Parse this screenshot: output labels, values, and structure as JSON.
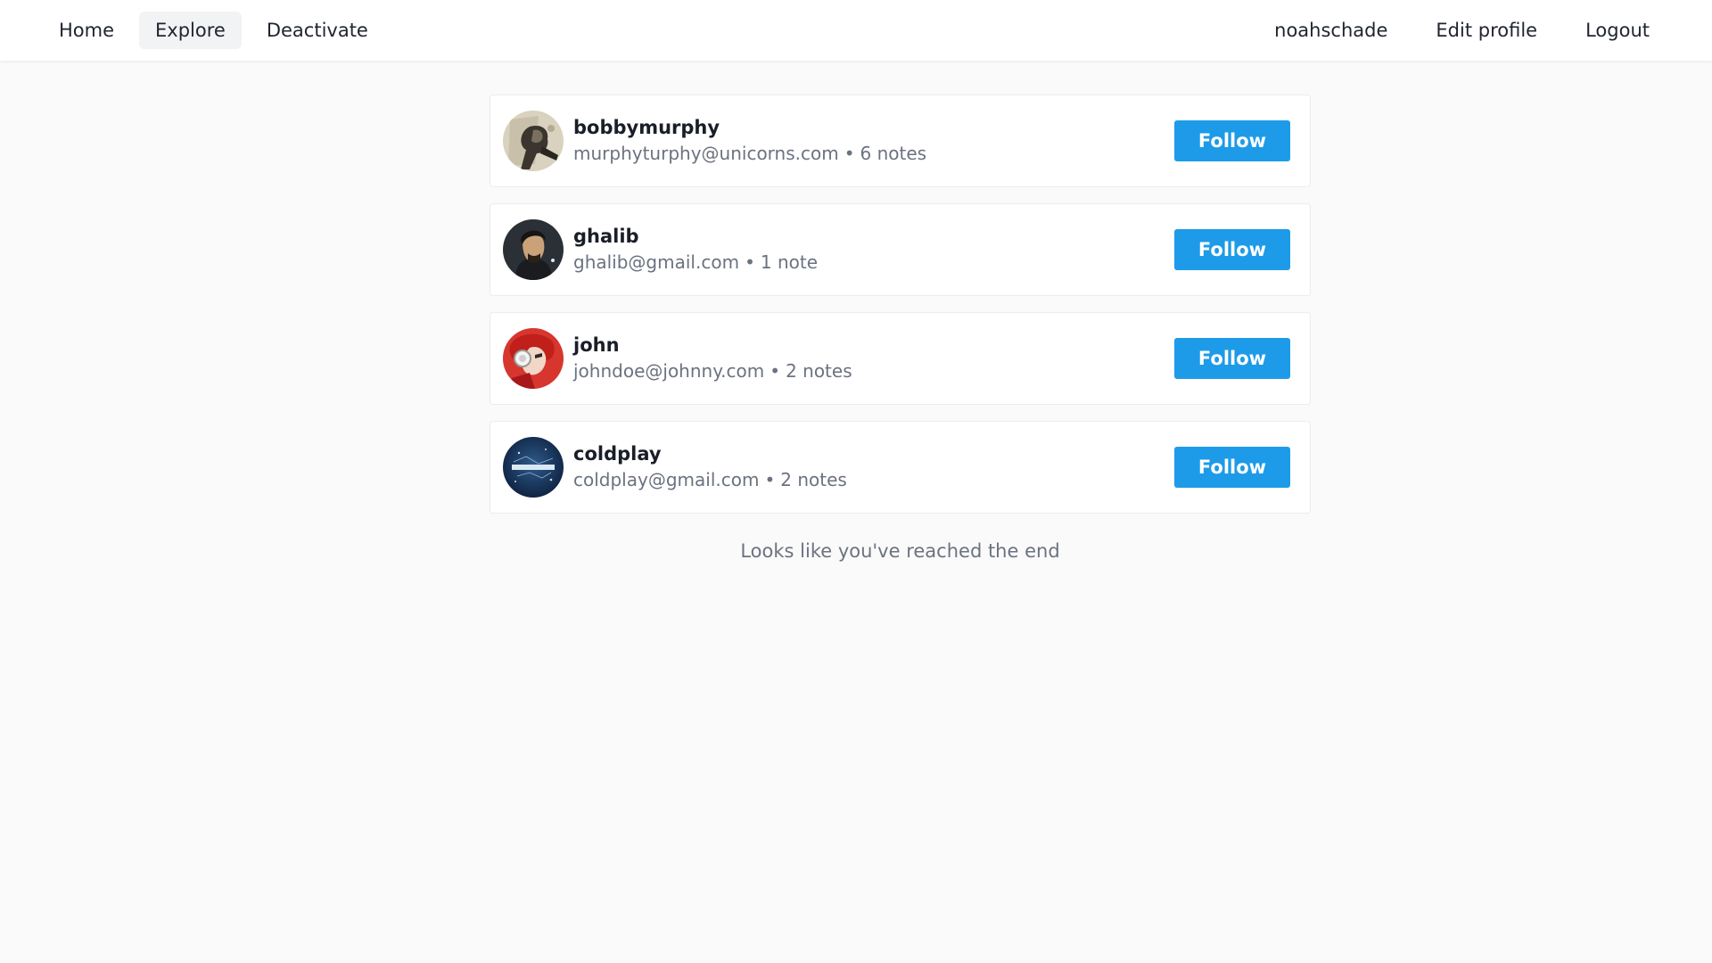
{
  "nav": {
    "left": [
      {
        "label": "Home",
        "active": false
      },
      {
        "label": "Explore",
        "active": true
      },
      {
        "label": "Deactivate",
        "active": false
      }
    ],
    "right": [
      {
        "label": "noahschade"
      },
      {
        "label": "Edit profile"
      },
      {
        "label": "Logout"
      }
    ]
  },
  "users": [
    {
      "username": "bobbymurphy",
      "email": "murphyturphy@unicorns.com",
      "notes": "6 notes",
      "follow_label": "Follow",
      "avatar": "bobbymurphy-avatar"
    },
    {
      "username": "ghalib",
      "email": "ghalib@gmail.com",
      "notes": "1 note",
      "follow_label": "Follow",
      "avatar": "ghalib-avatar"
    },
    {
      "username": "john",
      "email": "johndoe@johnny.com",
      "notes": "2 notes",
      "follow_label": "Follow",
      "avatar": "john-avatar"
    },
    {
      "username": "coldplay",
      "email": "coldplay@gmail.com",
      "notes": "2 notes",
      "follow_label": "Follow",
      "avatar": "coldplay-avatar"
    }
  ],
  "separator": "•",
  "end_message": "Looks like you've reached the end",
  "colors": {
    "accent": "#1d9be8",
    "background": "#fafafa",
    "muted_text": "#6b7280"
  }
}
